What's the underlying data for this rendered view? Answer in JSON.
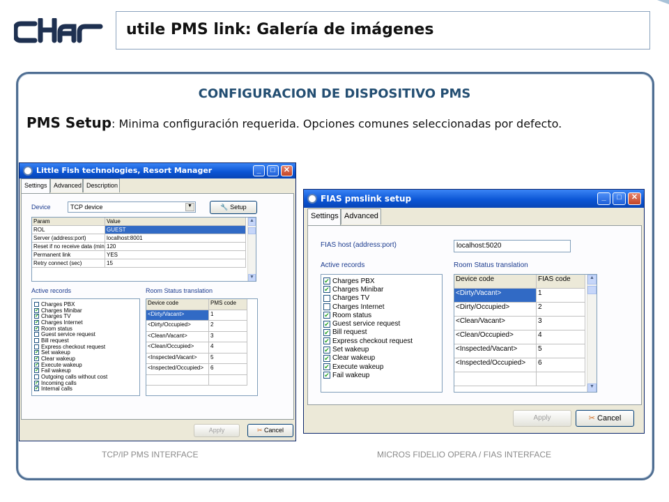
{
  "brand": {
    "logo_text": "cHar"
  },
  "slide": {
    "title": "utile PMS link: Galería de imágenes",
    "heading": "CONFIGURACION DE DISPOSITIVO PMS",
    "setup_bold": "PMS Setup",
    "setup_text": ": Minima configuración requerida. Opciones comunes seleccionadas por defecto."
  },
  "left_window": {
    "title": "Little Fish technologies, Resort Manager",
    "tabs": [
      "Settings",
      "Advanced",
      "Description"
    ],
    "device_label": "Device",
    "device_value": "TCP device",
    "setup_button": "Setup",
    "param_headers": [
      "Param",
      "Value"
    ],
    "params": [
      [
        "ROL",
        "GUEST"
      ],
      [
        "Server (address:port)",
        "localhost:8001"
      ],
      [
        "Reset if no receive data (minu",
        "120"
      ],
      [
        "Permanent link",
        "YES"
      ],
      [
        "Retry connect (sec)",
        "15"
      ]
    ],
    "active_records_label": "Active records",
    "records": [
      {
        "label": "Charges PBX",
        "checked": false
      },
      {
        "label": "Charges Minibar",
        "checked": true
      },
      {
        "label": "Charges TV",
        "checked": true
      },
      {
        "label": "Charges Internet",
        "checked": true
      },
      {
        "label": "Room status",
        "checked": true
      },
      {
        "label": "Guest service request",
        "checked": false
      },
      {
        "label": "Bill request",
        "checked": false
      },
      {
        "label": "Express checkout request",
        "checked": false
      },
      {
        "label": "Set wakeup",
        "checked": true
      },
      {
        "label": "Clear wakeup",
        "checked": true
      },
      {
        "label": "Execute wakeup",
        "checked": true
      },
      {
        "label": "Fail wakeup",
        "checked": true
      },
      {
        "label": "Outgoing calls without cost",
        "checked": false
      },
      {
        "label": "Incoming calls",
        "checked": true
      },
      {
        "label": "Internal calls",
        "checked": true
      }
    ],
    "room_status_label": "Room Status translation",
    "room_headers": [
      "Device code",
      "PMS code"
    ],
    "rooms": [
      [
        "<Dirty/Vacant>",
        "1"
      ],
      [
        "<Dirty/Occupied>",
        "2"
      ],
      [
        "<Clean/Vacant>",
        "3"
      ],
      [
        "<Clean/Occupied>",
        "4"
      ],
      [
        "<Inspected/Vacant>",
        "5"
      ],
      [
        "<Inspected/Occupied>",
        "6"
      ]
    ],
    "apply_button": "Apply",
    "cancel_button": "Cancel"
  },
  "right_window": {
    "title": "FIAS pmslink setup",
    "tabs": [
      "Settings",
      "Advanced"
    ],
    "host_label": "FIAS host (address:port)",
    "host_value": "localhost:5020",
    "active_records_label": "Active records",
    "records": [
      {
        "label": "Charges PBX",
        "checked": true
      },
      {
        "label": "Charges Minibar",
        "checked": true
      },
      {
        "label": "Charges TV",
        "checked": false
      },
      {
        "label": "Charges Internet",
        "checked": false
      },
      {
        "label": "Room status",
        "checked": true
      },
      {
        "label": "Guest service request",
        "checked": true
      },
      {
        "label": "Bill request",
        "checked": true
      },
      {
        "label": "Express checkout request",
        "checked": true
      },
      {
        "label": "Set wakeup",
        "checked": true
      },
      {
        "label": "Clear wakeup",
        "checked": true
      },
      {
        "label": "Execute wakeup",
        "checked": true
      },
      {
        "label": "Fail wakeup",
        "checked": true
      }
    ],
    "room_status_label": "Room Status translation",
    "room_headers": [
      "Device code",
      "FIAS code"
    ],
    "rooms": [
      [
        "<Dirty/Vacant>",
        "1"
      ],
      [
        "<Dirty/Occupied>",
        "2"
      ],
      [
        "<Clean/Vacant>",
        "3"
      ],
      [
        "<Clean/Occupied>",
        "4"
      ],
      [
        "<Inspected/Vacant>",
        "5"
      ],
      [
        "<Inspected/Occupied>",
        "6"
      ]
    ],
    "apply_button": "Apply",
    "cancel_button": "Cancel"
  },
  "captions": {
    "left": "TCP/IP PMS INTERFACE",
    "right": "MICROS FIDELIO OPERA / FIAS INTERFACE"
  },
  "colors": {
    "heading": "#234e72",
    "panel_border": "#4f6e92",
    "selection": "#316ac5"
  }
}
